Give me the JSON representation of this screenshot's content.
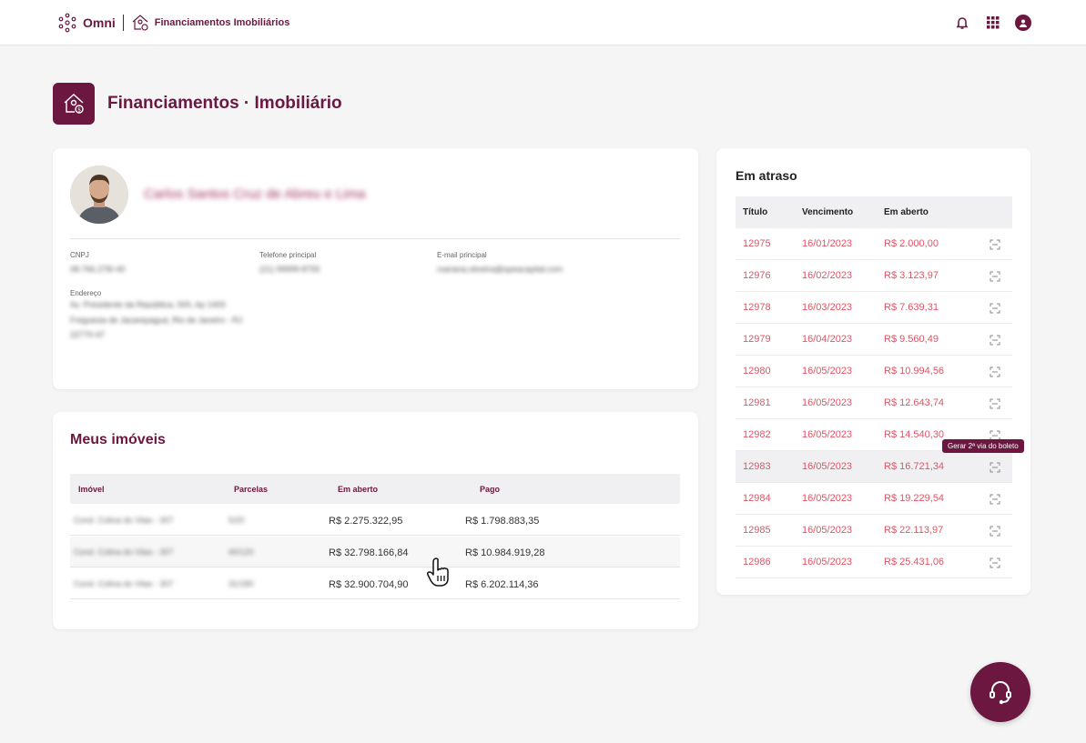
{
  "header": {
    "brand": "Omni",
    "app_name": "Financiamentos Imobiliários",
    "icons": [
      "bell-icon",
      "apps-grid-icon",
      "user-avatar-icon"
    ]
  },
  "page": {
    "title": "Financiamentos · Imobiliário"
  },
  "profile": {
    "name": "Carlos Santos Cruz de Abreu e Lima",
    "cnpj_label": "CNPJ",
    "cnpj_value": "08.766.278/-40",
    "phone_label": "Telefone principal",
    "phone_value": "(21) 99999-8755",
    "email_label": "E-mail principal",
    "email_value": "mariana.oliveira@opeacapital.com",
    "address_label": "Endereço",
    "address_lines": [
      "Av. Presidente da República, 500, Ap 1400",
      "Freguesia de Jacarepaguá, Rio de Janeiro - RJ",
      "22770-47"
    ]
  },
  "imoveis": {
    "title": "Meus imóveis",
    "columns": [
      "Imóvel",
      "Parcelas",
      "Em aberto",
      "Pago"
    ],
    "rows": [
      {
        "imovel": "Cond. Colina do Vilas - 307",
        "parcelas": "5/20",
        "aberto": "R$ 2.275.322,95",
        "pago": "R$ 1.798.883,35"
      },
      {
        "imovel": "Cond. Colina do Vilas - 307",
        "parcelas": "40/120",
        "aberto": "R$ 32.798.166,84",
        "pago": "R$ 10.984.919,28"
      },
      {
        "imovel": "Cond. Colina do Vilas - 307",
        "parcelas": "31/180",
        "aberto": "R$ 32.900.704,90",
        "pago": "R$ 6.202.114,36"
      }
    ]
  },
  "atraso": {
    "title": "Em atraso",
    "columns": [
      "Título",
      "Vencimento",
      "Em aberto"
    ],
    "rows": [
      {
        "titulo": "12975",
        "venc": "16/01/2023",
        "aberto": "R$ 2.000,00"
      },
      {
        "titulo": "12976",
        "venc": "16/02/2023",
        "aberto": "R$ 3.123,97"
      },
      {
        "titulo": "12978",
        "venc": "16/03/2023",
        "aberto": "R$ 7.639,31"
      },
      {
        "titulo": "12979",
        "venc": "16/04/2023",
        "aberto": "R$ 9.560,49"
      },
      {
        "titulo": "12980",
        "venc": "16/05/2023",
        "aberto": "R$ 10.994,56"
      },
      {
        "titulo": "12981",
        "venc": "16/05/2023",
        "aberto": "R$ 12.643,74"
      },
      {
        "titulo": "12982",
        "venc": "16/05/2023",
        "aberto": "R$ 14.540,30"
      },
      {
        "titulo": "12983",
        "venc": "16/05/2023",
        "aberto": "R$ 16.721,34"
      },
      {
        "titulo": "12984",
        "venc": "16/05/2023",
        "aberto": "R$ 19.229,54"
      },
      {
        "titulo": "12985",
        "venc": "16/05/2023",
        "aberto": "R$ 22.113,97"
      },
      {
        "titulo": "12986",
        "venc": "16/05/2023",
        "aberto": "R$ 25.431,06"
      }
    ],
    "tooltip": "Gerar 2ª via do boleto"
  },
  "colors": {
    "brand": "#6b1740",
    "overdue": "#e05465"
  }
}
